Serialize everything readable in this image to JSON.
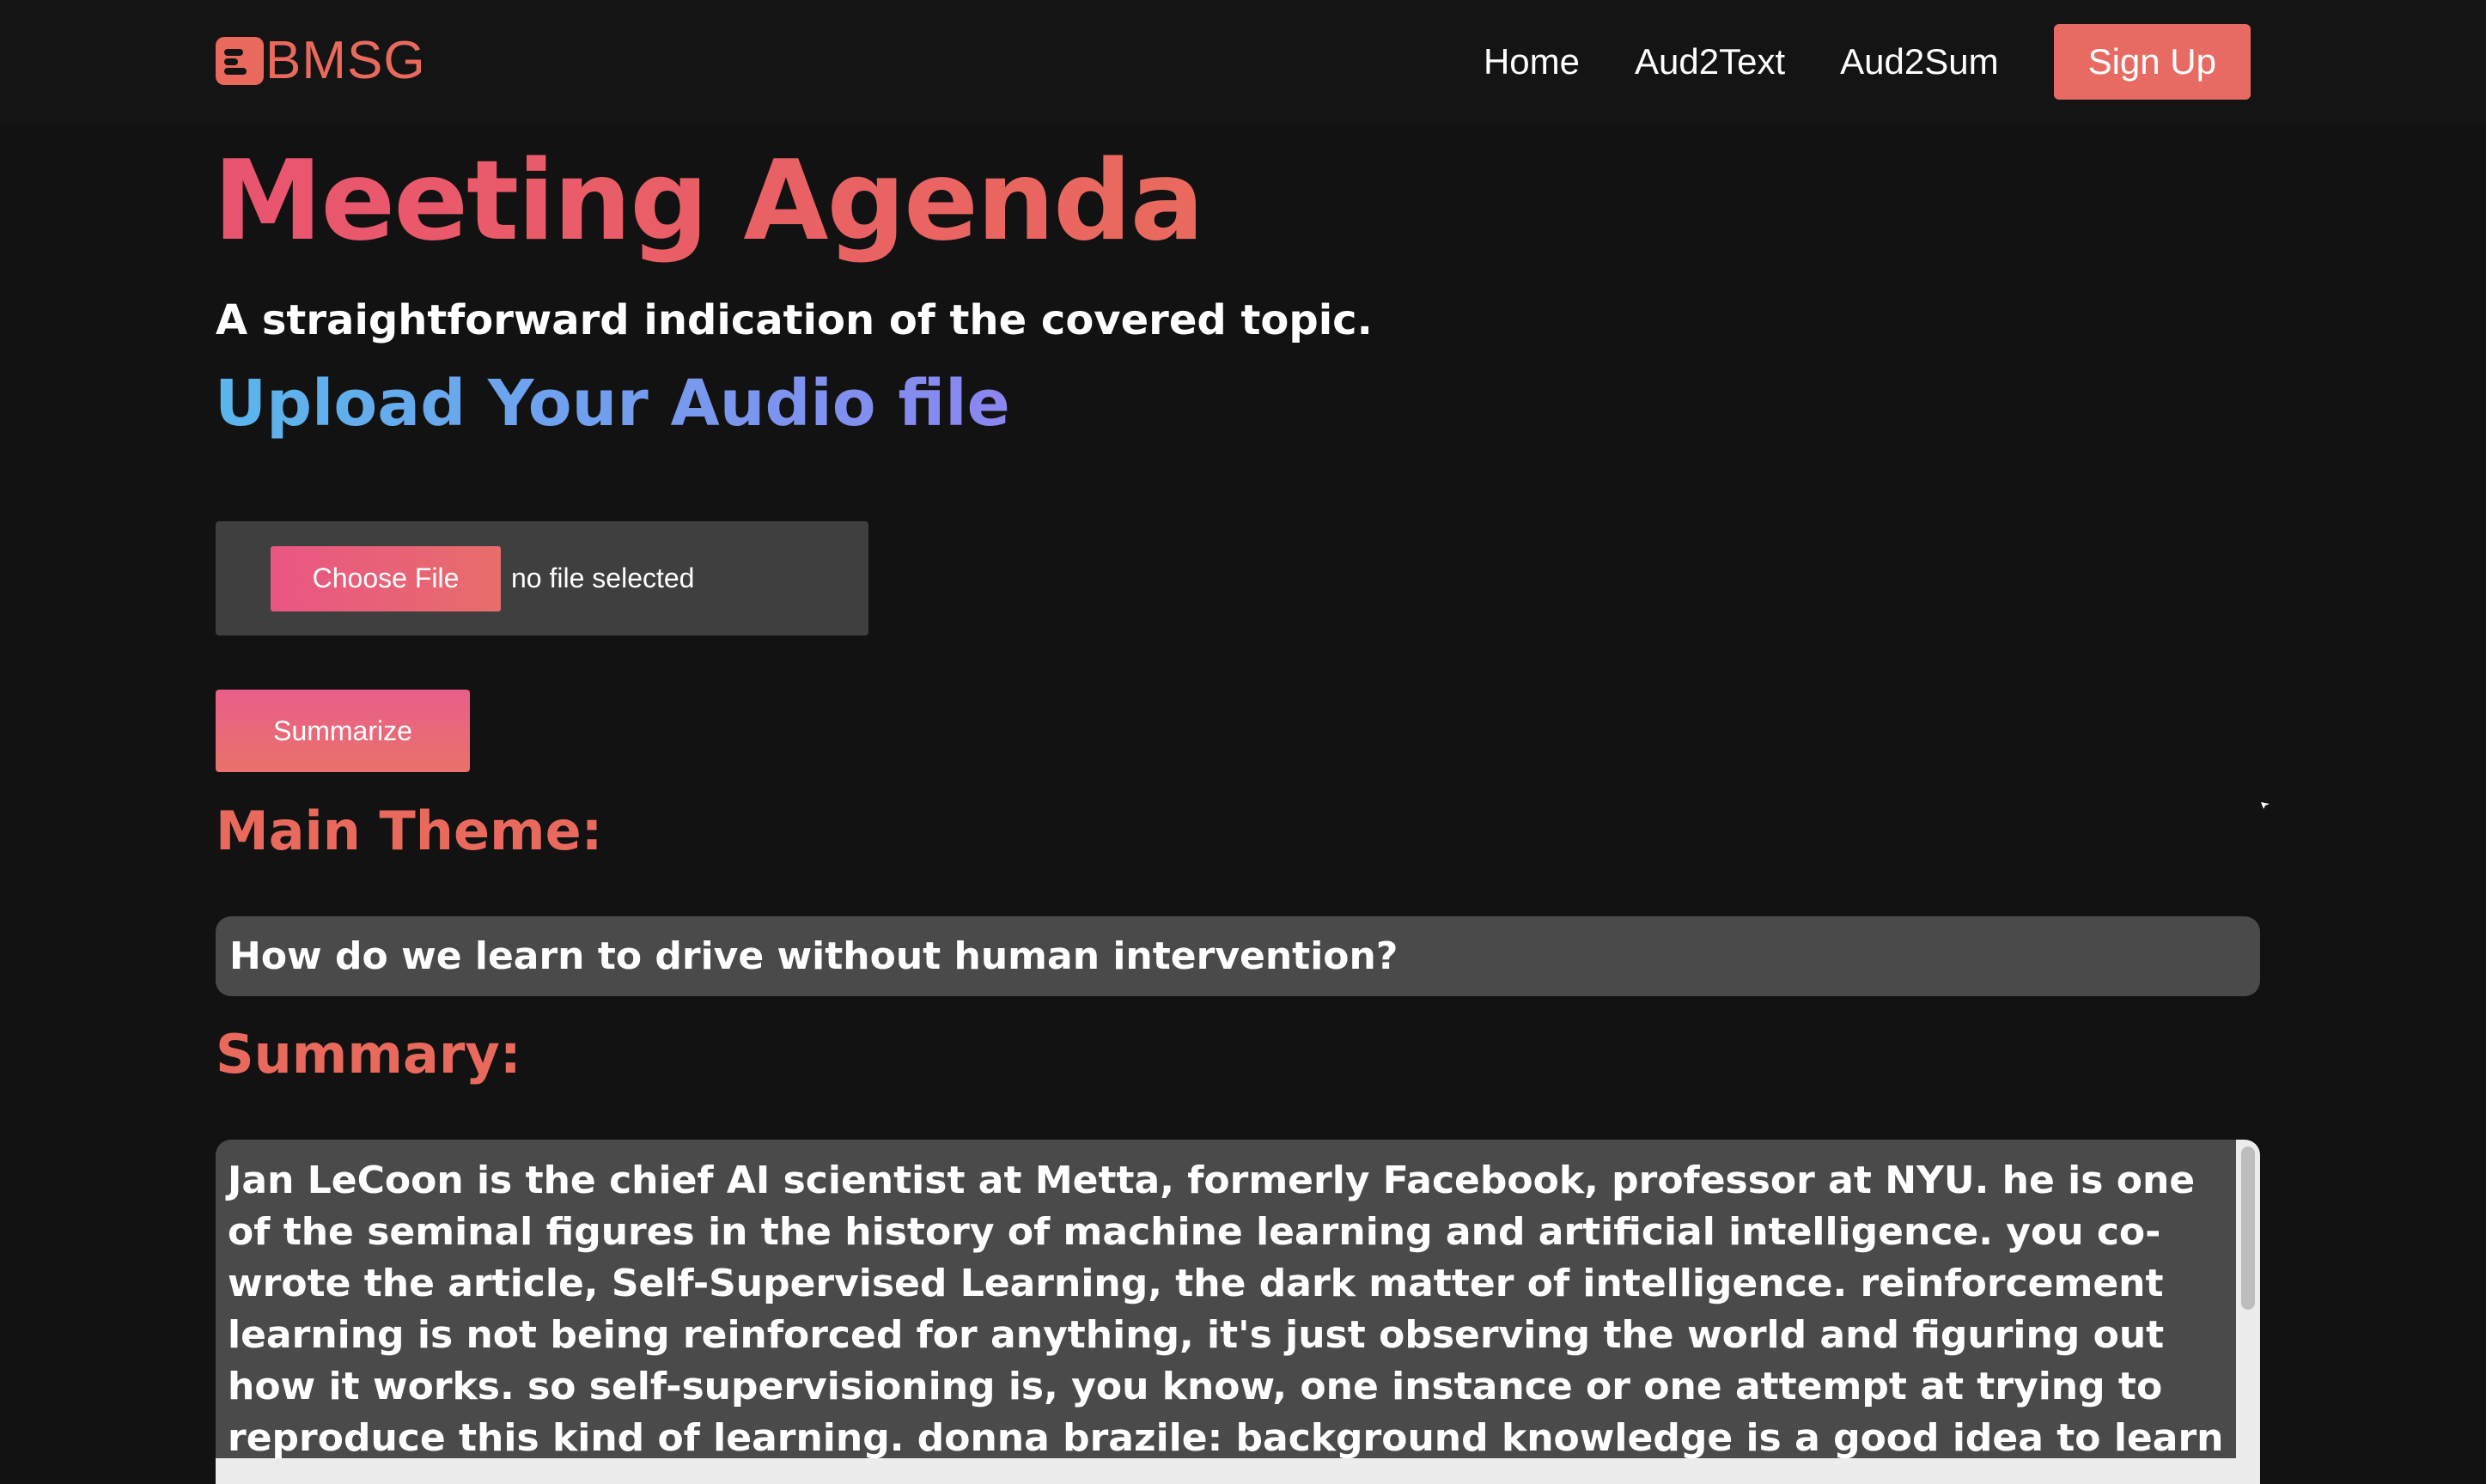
{
  "header": {
    "logo_text": "BMSG",
    "nav": [
      {
        "label": "Home"
      },
      {
        "label": "Aud2Text"
      },
      {
        "label": "Aud2Sum"
      }
    ],
    "signup_label": "Sign Up"
  },
  "hero": {
    "title": "Meeting Agenda",
    "subtitle": "A straightforward indication of the covered topic.",
    "upload_title": "Upload Your Audio file"
  },
  "upload": {
    "choose_label": "Choose File",
    "file_status": "no file selected",
    "summarize_label": "Summarize"
  },
  "results": {
    "main_theme_label": "Main Theme:",
    "main_theme": "How do we learn to drive without human intervention?",
    "summary_label": "Summary:",
    "summary": "Jan LeCoon is the chief AI scientist at Metta, formerly Facebook, professor at NYU. he is one of the seminal figures in the history of machine learning and artificial intelligence. you co-wrote the article, Self-Supervised Learning, the dark matter of intelligence. reinforcement learning is not being reinforced for anything, it's just observing the world and figuring out how it works. so self-supervisioning is, you know, one instance or one attempt at trying to reproduce this kind of learning. donna brazile: background knowledge is a good idea to learn to drive. she says if you are a tabularized"
  },
  "colors": {
    "accent": "#e96a5d",
    "background": "#121212",
    "panel": "#4a4a4a"
  }
}
